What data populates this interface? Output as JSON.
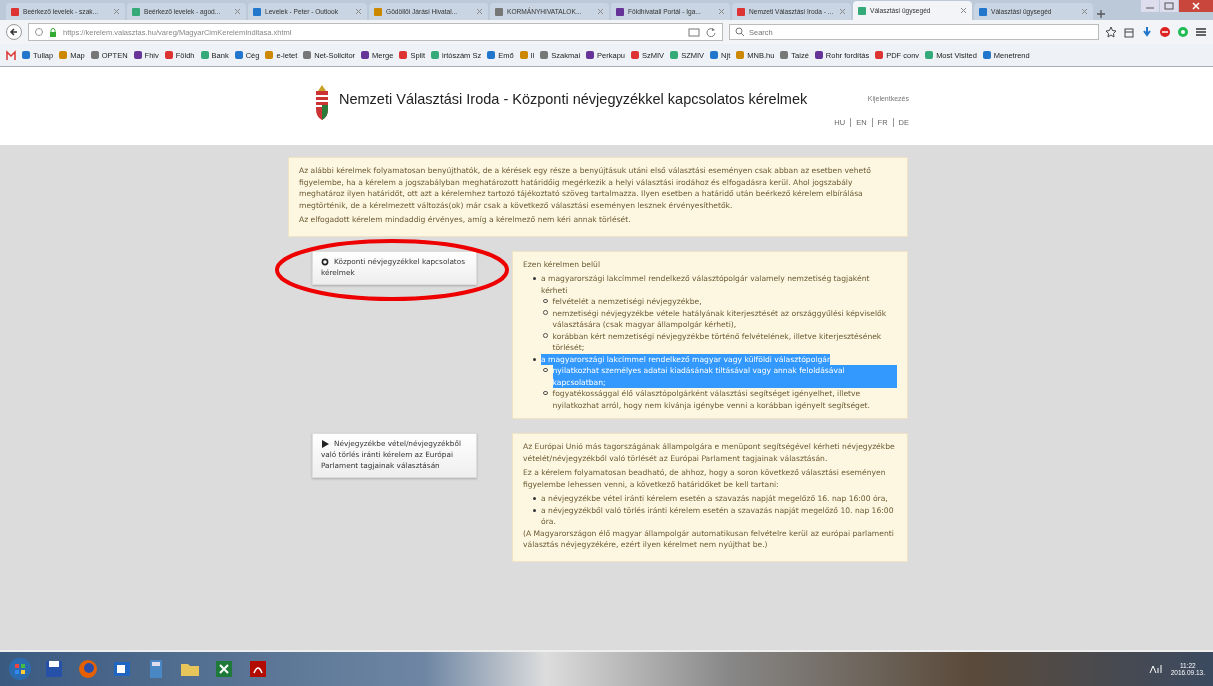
{
  "browser": {
    "tabs": [
      {
        "label": "Beérkező levelek - szak...",
        "selected": false
      },
      {
        "label": "Beérkező levelek - agod...",
        "selected": false
      },
      {
        "label": "Levelek - Peter - Outlook",
        "selected": false
      },
      {
        "label": "Gödöllői Járási Hivatal...",
        "selected": false
      },
      {
        "label": "KORMÁNYHIVATALOK...",
        "selected": false
      },
      {
        "label": "Földhivatali Portál - Iga...",
        "selected": false
      },
      {
        "label": "Nemzeti Választási Iroda - ...",
        "selected": false
      },
      {
        "label": "Választási ügysegéd",
        "selected": true
      },
      {
        "label": "Választási ügysegéd",
        "selected": false
      }
    ],
    "url": "https://kerelem.valasztas.hu/vareg/MagyarCimKerelemInditasa.xhtml",
    "search": {
      "placeholder": "Search"
    },
    "bookmarks": [
      "Tullap",
      "Map",
      "OPTEN",
      "Fhiv",
      "Földh",
      "Bank",
      "Cég",
      "e-letet",
      "Net-Solicitor",
      "Merge",
      "Split",
      "irtószám Sz",
      "Emő",
      "Il",
      "Szakmai",
      "Perkapu",
      "SzMIV",
      "SZMIV",
      "Njt",
      "MNB.hu",
      "Taizé",
      "Rohr fordítás",
      "PDF conv",
      "Most Visited",
      "Menetrend"
    ]
  },
  "header": {
    "title": "Nemzeti Választási Iroda - Központi névjegyzékkel kapcsolatos kérelmek",
    "logout": "Kijelentkezés",
    "languages": [
      "HU",
      "EN",
      "FR",
      "DE"
    ]
  },
  "notice": [
    "Az alábbi kérelmek folyamatosan benyújthatók, de a kérések egy része a benyújtásuk utáni első választási eseményen csak abban az esetben vehető figyelembe, ha a kérelem a jogszabályban meghatározott határidőig megérkezik a helyi választási irodához és elfogadásra kerül. Ahol jogszabály meghatároz ilyen határidőt, ott azt a kérelemhez tartozó tájékoztató szöveg tartalmazza. Ilyen esetben a határidő után beérkező kérelem elbírálása megtörténik, de a kérelmezett változás(ok) már csak a következő választási eseményen lesznek érvényesíthetők.",
    "Az elfogadott kérelem mindaddig érvényes, amíg a kérelmező nem kéri annak törlését."
  ],
  "sections": [
    {
      "menu": {
        "label": "Központi névjegyzékkel kapcsolatos kérelmek",
        "kind": "gear",
        "circled": true
      },
      "blocks": [
        {
          "kind": "paragraph",
          "text": "Ezen kérelmen belül"
        },
        {
          "kind": "list",
          "items": [
            {
              "text": "a magyarországi lakcímmel rendelkező választópolgár valamely nemzetiség tagjaként kérheti",
              "highlighted": false,
              "children": [
                {
                  "text": "felvételét a nemzetiségi névjegyzékbe,",
                  "highlighted": false
                },
                {
                  "text": "nemzetiségi névjegyzékbe vétele hatályának kiterjesztését az országgyűlési képviselők választására (csak magyar állampolgár kérheti),",
                  "highlighted": false
                },
                {
                  "text": "korábban kért nemzetiségi névjegyzékbe történő felvételének, illetve kiterjesztésének törlését;",
                  "highlighted": false
                }
              ]
            },
            {
              "text": "a magyarországi lakcímmel rendelkező magyar vagy külföldi választópolgár",
              "highlighted": true,
              "children": [
                {
                  "text": "nyilatkozhat személyes adatai kiadásának tiltásával vagy annak feloldásával kapcsolatban;",
                  "highlighted": true
                },
                {
                  "text": "fogyatékossággal élő választópolgárként választási segítséget igényelhet, illetve nyilatkozhat arról, hogy nem kívánja igénybe venni a korábban igényelt segítséget.",
                  "highlighted": false
                }
              ]
            }
          ]
        }
      ]
    },
    {
      "menu": {
        "label": "Névjegyzékbe vétel/névjegyzékből való törlés iránti kérelem az Európai Parlament tagjainak választásán",
        "kind": "triangle",
        "circled": false
      },
      "blocks": [
        {
          "kind": "paragraph",
          "text": "Az Európai Unió más tagországának állampolgára e menüpont segítségével kérheti névjegyzékbe vételét/névjegyzékből való törlését az Európai Parlament tagjainak választásán."
        },
        {
          "kind": "paragraph",
          "text": "Ez a kérelem folyamatosan beadható, de ahhoz, hogy a soron következő választási eseményen figyelembe lehessen venni, a következő határidőket be kell tartani:"
        },
        {
          "kind": "list",
          "items": [
            {
              "text": "a névjegyzékbe vétel iránti kérelem esetén a szavazás napját megelőző 16. nap 16:00 óra,",
              "highlighted": false
            },
            {
              "text": "a névjegyzékből való törlés iránti kérelem esetén a szavazás napját megelőző 10. nap 16:00 óra.",
              "highlighted": false
            }
          ]
        },
        {
          "kind": "paragraph",
          "text": "(A Magyarországon élő magyar állampolgár automatikusan felvételre kerül az európai parlamenti választás névjegyzékére, ezért ilyen kérelmet nem nyújthat be.)"
        }
      ]
    }
  ],
  "taskbar": {
    "time": "11:22",
    "date": "2016.09.13."
  }
}
